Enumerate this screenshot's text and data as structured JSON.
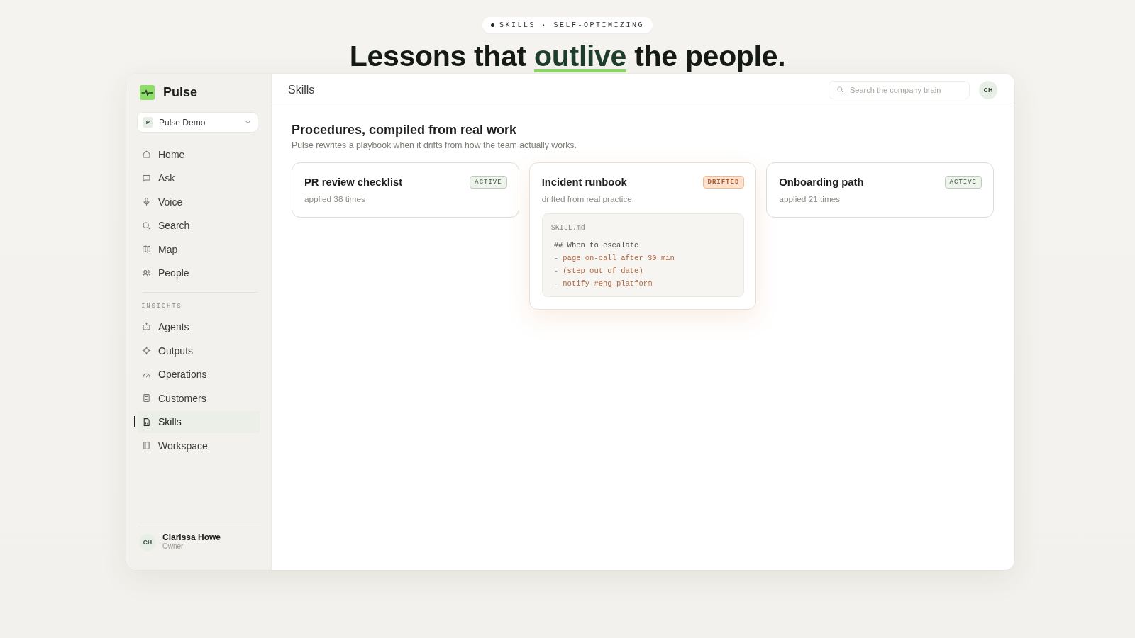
{
  "hero": {
    "badge": "SKILLS · SELF-OPTIMIZING",
    "headline": {
      "before": "Lessons that",
      "highlight": "outlive",
      "after": "the people."
    }
  },
  "sidebar": {
    "brand": "Pulse",
    "workspace": {
      "initial": "P",
      "name": "Pulse Demo"
    },
    "nav": [
      {
        "label": "Home",
        "selected": false
      },
      {
        "label": "Ask",
        "selected": false
      },
      {
        "label": "Voice",
        "selected": false
      },
      {
        "label": "Search",
        "selected": false
      },
      {
        "label": "Map",
        "selected": false
      },
      {
        "label": "People",
        "selected": false
      }
    ],
    "sections": [
      {
        "heading": "INSIGHTS",
        "items": [
          {
            "label": "Agents",
            "selected": false
          },
          {
            "label": "Outputs",
            "selected": false
          },
          {
            "label": "Operations",
            "selected": false
          },
          {
            "label": "Customers",
            "selected": false
          },
          {
            "label": "Skills",
            "selected": true
          },
          {
            "label": "Workspace",
            "selected": false
          }
        ]
      }
    ],
    "user": {
      "initials": "CH",
      "name": "Clarissa Howe",
      "role": "Owner"
    }
  },
  "topbar": {
    "title": "Skills",
    "search": {
      "placeholder": "Search the company brain"
    },
    "avatar": "CH"
  },
  "content": {
    "heading": "Procedures, compiled from real work",
    "subtitle": "Pulse rewrites a playbook when it drifts from how the team actually works.",
    "cards": [
      {
        "title": "PR review checklist",
        "caption": "applied 38 times",
        "status": {
          "label": "ACTIVE",
          "kind": "active"
        }
      },
      {
        "title": "Incident runbook",
        "caption": "drifted from real practice",
        "status": {
          "label": "DRIFTED",
          "kind": "drifted"
        },
        "file": {
          "name": "SKILL.md",
          "lines": [
            {
              "kind": "heading",
              "marker": "##",
              "text": "When to escalate"
            },
            {
              "kind": "item",
              "marker": "-",
              "text": "page on-call after 30 min"
            },
            {
              "kind": "item",
              "marker": "-",
              "text": "(step out of date)"
            },
            {
              "kind": "item",
              "marker": "-",
              "text": "notify #eng-platform"
            }
          ]
        }
      },
      {
        "title": "Onboarding path",
        "caption": "applied 21 times",
        "status": {
          "label": "ACTIVE",
          "kind": "active"
        }
      }
    ]
  }
}
